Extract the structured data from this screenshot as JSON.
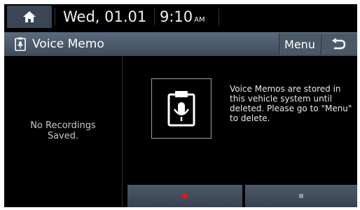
{
  "status": {
    "date": "Wed, 01.01",
    "time": "9:10",
    "ampm": "AM"
  },
  "header": {
    "title": "Voice Memo",
    "menu_label": "Menu",
    "title_icon": "voice-memo-icon",
    "back_icon": "back-arrow-icon",
    "home_icon": "home-icon"
  },
  "left": {
    "empty_line1": "No Recordings",
    "empty_line2": "Saved."
  },
  "info": {
    "icon": "clipboard-microphone-icon",
    "text": "Voice Memos are stored in this vehicle system until deleted. Please go to \"Menu\" to delete."
  },
  "controls": {
    "record_icon": "record-icon",
    "stop_icon": "stop-icon",
    "record_color": "#e01818"
  }
}
